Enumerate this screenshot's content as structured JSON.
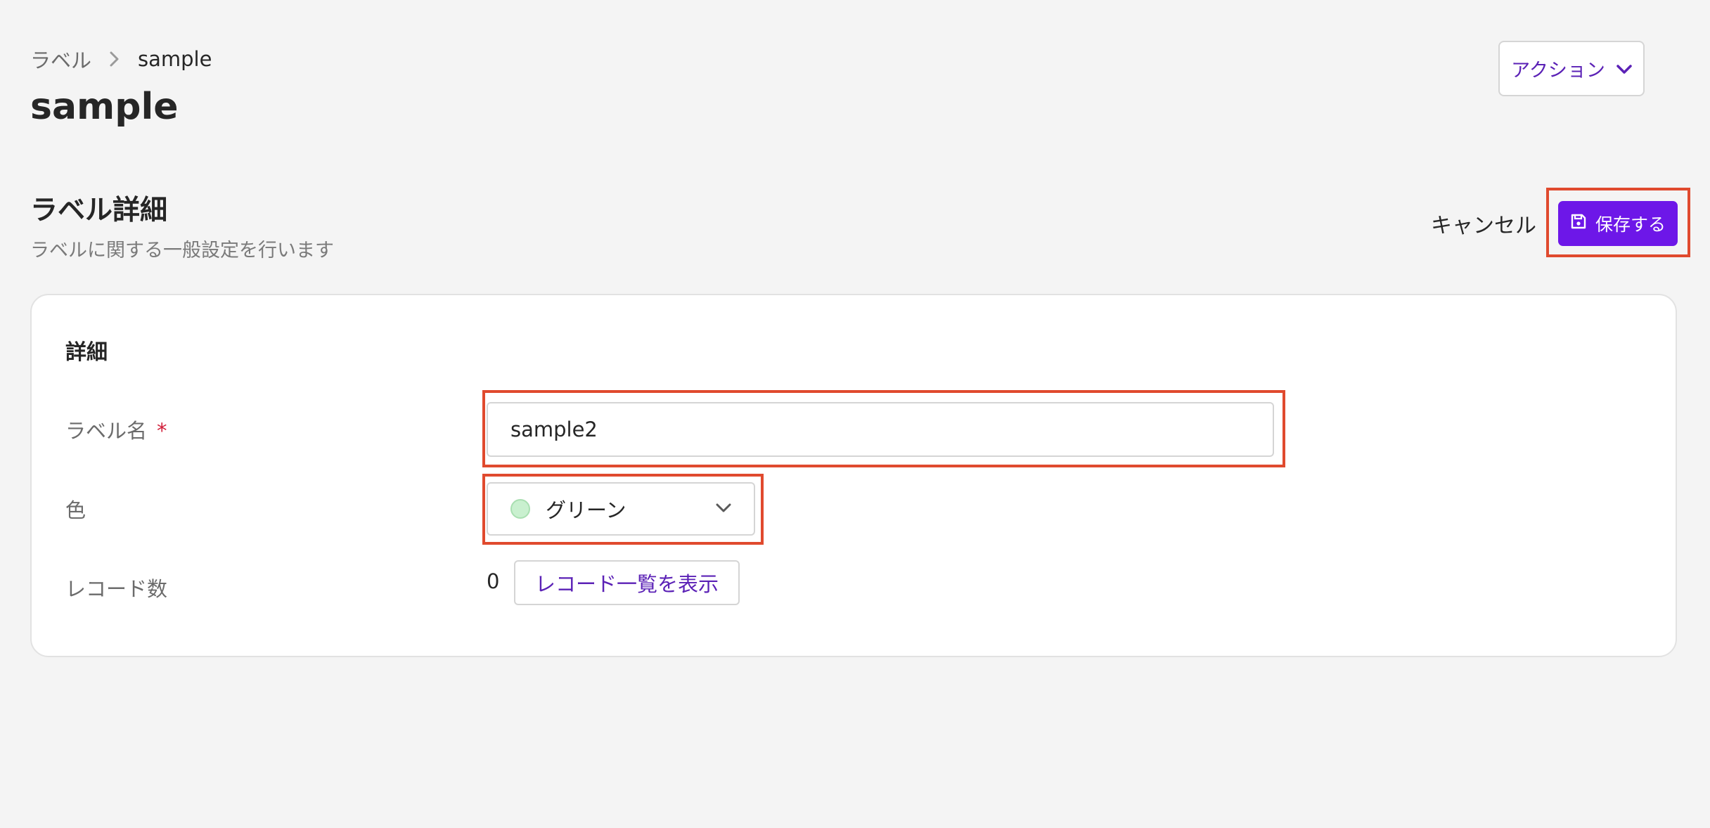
{
  "breadcrumb": {
    "parent": "ラベル",
    "current": "sample"
  },
  "page": {
    "title": "sample"
  },
  "header": {
    "action_label": "アクション"
  },
  "section": {
    "title": "ラベル詳細",
    "description": "ラベルに関する一般設定を行います",
    "cancel_label": "キャンセル",
    "save_label": "保存する"
  },
  "card": {
    "title": "詳細",
    "fields": {
      "name": {
        "label": "ラベル名",
        "required_mark": "*",
        "value": "sample2"
      },
      "color": {
        "label": "色",
        "value": "グリーン",
        "swatch": "#c9f0cf"
      },
      "records": {
        "label": "レコード数",
        "count": "0",
        "button_label": "レコード一覧を表示"
      }
    }
  },
  "colors": {
    "accent": "#6d17e8",
    "link": "#5b21b6",
    "highlight": "#e04a2e"
  }
}
